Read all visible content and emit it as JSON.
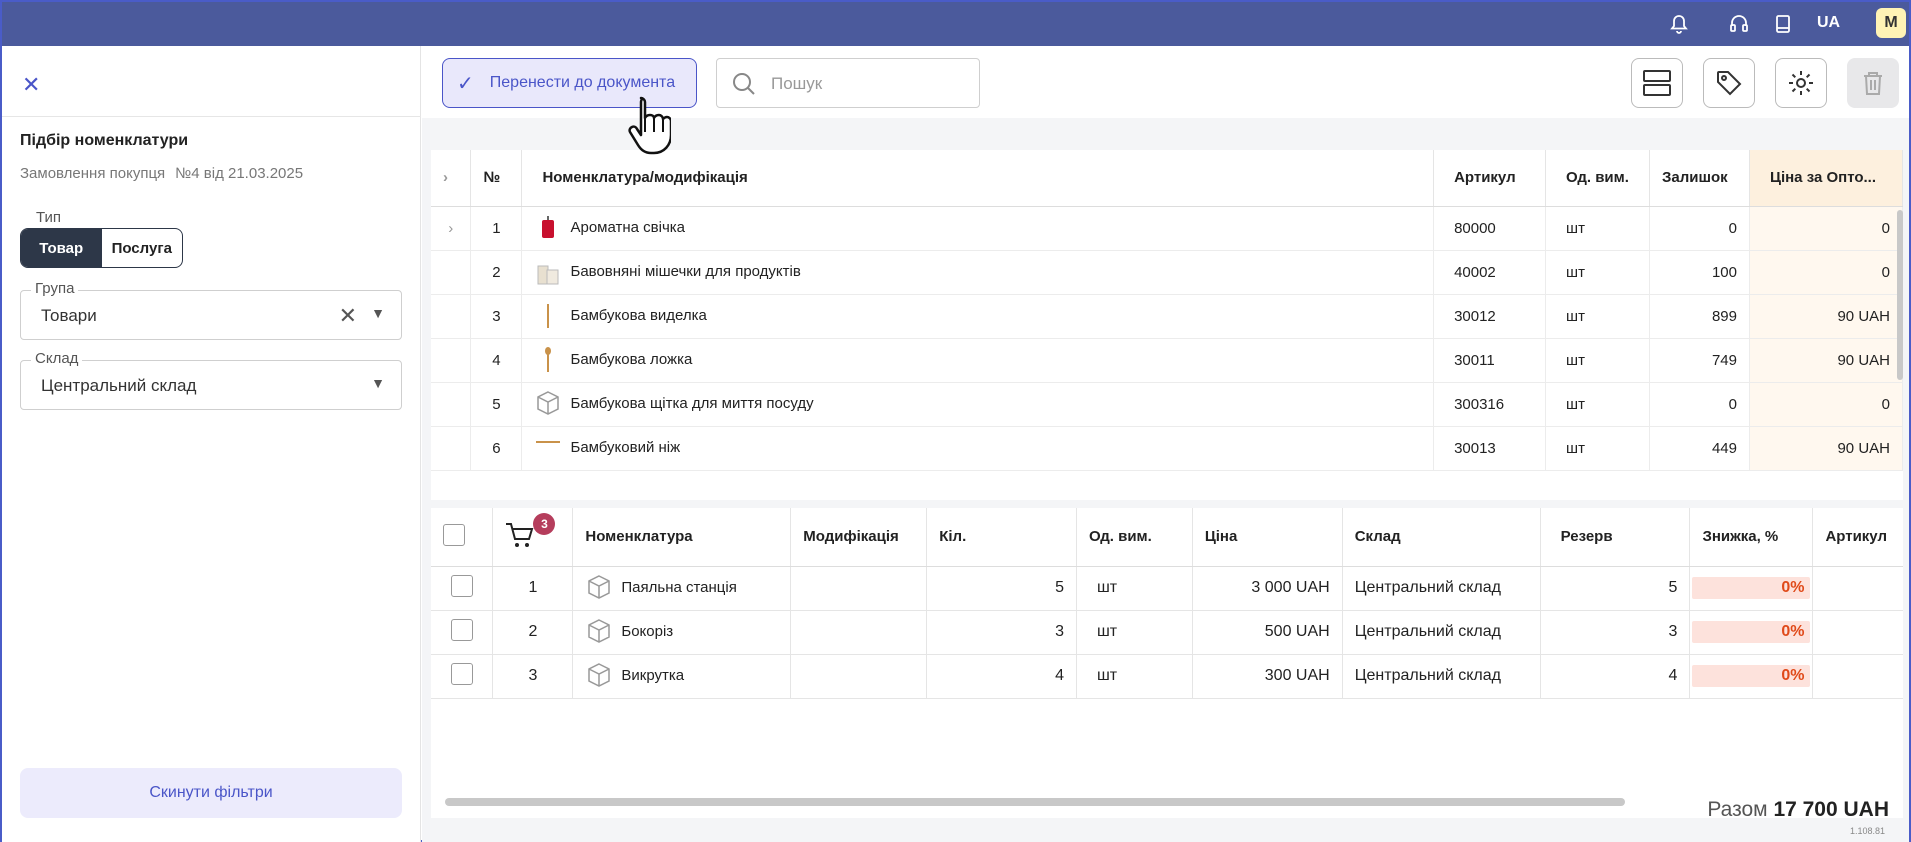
{
  "topbar": {
    "lang": "UA",
    "avatar": "M",
    "icons": [
      "bell-icon",
      "headset-icon",
      "book-icon"
    ]
  },
  "sidebar": {
    "title": "Підбір номенклатури",
    "doc_type": "Замовлення покупця",
    "doc_number": "№4 від 21.03.2025",
    "type_label": "Тип",
    "type_options": [
      "Товар",
      "Послуга"
    ],
    "group_label": "Група",
    "group_value": "Товари",
    "warehouse_label": "Склад",
    "warehouse_value": "Центральний склад",
    "reset_label": "Скинути фільтри"
  },
  "toolbar": {
    "transfer_label": "Перенести до документа",
    "search_placeholder": "Пошук"
  },
  "catalog": {
    "headers": [
      "№",
      "Номенклатура/модифікація",
      "Артикул",
      "Од. вим.",
      "Залишок",
      "Ціна за Опто..."
    ],
    "rows": [
      {
        "n": "1",
        "name": "Ароматна свічка",
        "sku": "80000",
        "unit": "шт",
        "stock": "0",
        "price": "0",
        "icon": "candle-icon"
      },
      {
        "n": "2",
        "name": "Бавовняні мішечки для продуктів",
        "sku": "40002",
        "unit": "шт",
        "stock": "100",
        "price": "0",
        "icon": "bags-icon"
      },
      {
        "n": "3",
        "name": "Бамбукова виделка",
        "sku": "30012",
        "unit": "шт",
        "stock": "899",
        "price": "90  UAH",
        "icon": "fork-icon"
      },
      {
        "n": "4",
        "name": "Бамбукова ложка",
        "sku": "30011",
        "unit": "шт",
        "stock": "749",
        "price": "90  UAH",
        "icon": "spoon-icon"
      },
      {
        "n": "5",
        "name": "Бамбукова щітка для миття посуду",
        "sku": "300316",
        "unit": "шт",
        "stock": "0",
        "price": "0",
        "icon": "box-icon"
      },
      {
        "n": "6",
        "name": "Бамбуковий ніж",
        "sku": "30013",
        "unit": "шт",
        "stock": "449",
        "price": "90  UAH",
        "icon": "knife-icon"
      }
    ]
  },
  "cart": {
    "badge": "3",
    "headers": [
      "Номенклатура",
      "Модифікація",
      "Кіл.",
      "Од. вим.",
      "Ціна",
      "Склад",
      "Резерв",
      "Знижка, %",
      "Артикул"
    ],
    "rows": [
      {
        "n": "1",
        "name": "Паяльна станція",
        "qty": "5",
        "unit": "шт",
        "price": "3 000  UAH",
        "warehouse": "Центральний склад",
        "reserve": "5",
        "discount": "0%"
      },
      {
        "n": "2",
        "name": "Бокоріз",
        "qty": "3",
        "unit": "шт",
        "price": "500  UAH",
        "warehouse": "Центральний склад",
        "reserve": "3",
        "discount": "0%"
      },
      {
        "n": "3",
        "name": "Викрутка",
        "qty": "4",
        "unit": "шт",
        "price": "300  UAH",
        "warehouse": "Центральний склад",
        "reserve": "4",
        "discount": "0%"
      }
    ]
  },
  "footer": {
    "total_label": "Разом",
    "total_value": "17 700 UAH",
    "version": "1.108.81"
  }
}
